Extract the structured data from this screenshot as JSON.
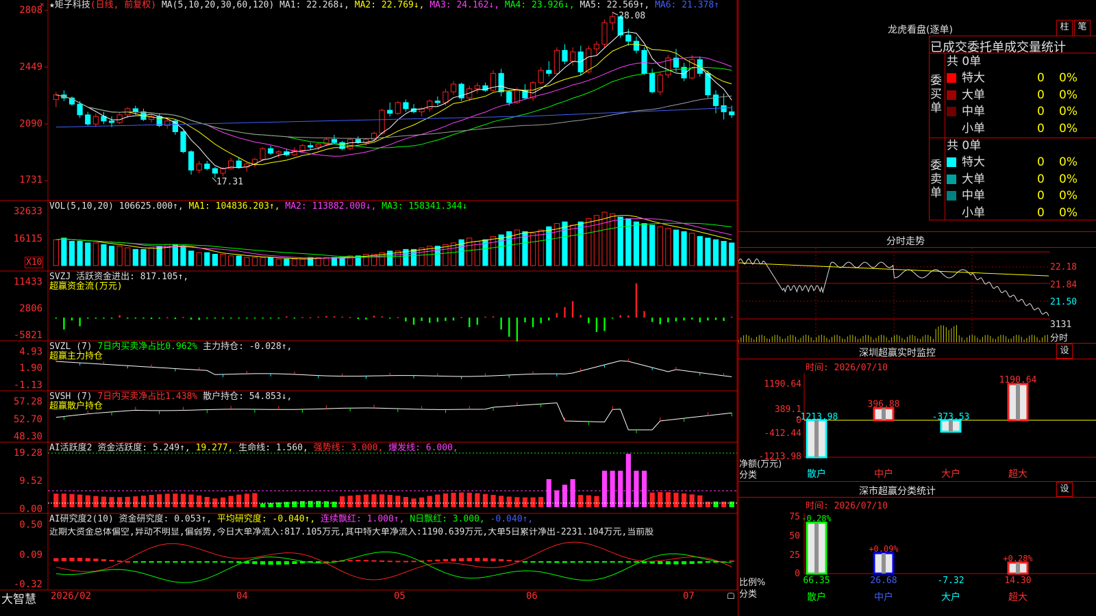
{
  "stock": {
    "name": "★矩子科技",
    "mode": "(日线, 前复权)"
  },
  "colors": {
    "up": "#ff2020",
    "down": "#00ffff",
    "ma1": "#ffffff",
    "ma2": "#ffff00",
    "ma3": "#ff40ff",
    "ma4": "#00ff00",
    "ma5": "#a0a0a0",
    "ma6": "#4060ff"
  },
  "k": {
    "header": {
      "ma": "MA(5,10,20,30,60,120)",
      "ma1": "MA1: 22.268↓,",
      "ma2": "MA2: 22.769↓,",
      "ma3": "MA3: 24.162↓,",
      "ma4": "MA4: 23.926↓,",
      "ma5": "MA5: 22.569↑,",
      "ma6": "MA6: 21.378↑"
    },
    "yticks": [
      "2808",
      "2449",
      "2090",
      "1731"
    ],
    "high_label": "28.08",
    "low_label": "17.31"
  },
  "vol": {
    "header": {
      "name": "VOL(5,10,20)",
      "v": "106625.000↑,",
      "ma1": "MA1: 104836.203↑,",
      "ma2": "MA2: 113882.000↓,",
      "ma3": "MA3: 158341.344↓"
    },
    "yticks": [
      "32633",
      "16115"
    ],
    "unit": "X10"
  },
  "svzj": {
    "header": {
      "name": "SVZJ",
      "t1": "活跃资金进出: 817.105↑,",
      "t2": "超赢资金流(万元)"
    },
    "yticks": [
      "11433",
      "2806",
      "-5821"
    ]
  },
  "svzl": {
    "header": {
      "name": "SVZL (7)",
      "t1": "7日内买卖净占比0.962%",
      "t2": "主力持仓: -0.028↑,",
      "t3": "超赢主力持仓"
    },
    "yticks": [
      "4.93",
      "1.90",
      "-1.13"
    ]
  },
  "svsh": {
    "header": {
      "name": "SVSH (7)",
      "t1": "7日内买卖净占比1.438%",
      "t2": "散户持仓: 54.853↓,",
      "t3": "超赢散户持仓"
    },
    "yticks": [
      "57.28",
      "52.70",
      "48.30"
    ]
  },
  "ai1": {
    "header": {
      "name": "AI活跃度2",
      "t1": "资金活跃度: 5.249↑,",
      "t2": "19.277,",
      "t3": "生命线: 1.560,",
      "t4": "强势线: 3.000,",
      "t5": "爆发线: 6.000,"
    },
    "yticks": [
      "19.28",
      "9.52",
      "0.00"
    ]
  },
  "ai2": {
    "header": {
      "name": "AI研究度2(10)",
      "t1": "资金研究度: 0.053↑,",
      "t2": "平均研究度: -0.040↑,",
      "t3": "连续飘红: 1.000↑,",
      "t4": "N日飘红: 3.000,",
      "t5": "-0.040↑,"
    },
    "desc": "近期大资金总体偏空,异动不明显,偏弱势,今日大单净流入:817.105万元,其中特大单净流入:1190.639万元,大单5日累计净出-2231.104万元,当前股",
    "yticks": [
      "0.50",
      "0.09",
      "-0.32"
    ]
  },
  "xaxis": {
    "labels": [
      "2026/02",
      "04",
      "05",
      "06",
      "07"
    ]
  },
  "footer": {
    "brand": "大智慧"
  },
  "right": {
    "lhb": {
      "title": "龙虎看盘(逐单)",
      "btn1": "柱",
      "btn2": "笔",
      "subtitle": "已成交委托单成交量统计"
    },
    "buy": {
      "side": "委买单",
      "total": "共 0单",
      "rows": [
        {
          "label": "特大",
          "v": "0",
          "p": "0%",
          "color": "#ff0000"
        },
        {
          "label": "大单",
          "v": "0",
          "p": "0%",
          "color": "#a00000"
        },
        {
          "label": "中单",
          "v": "0",
          "p": "0%",
          "color": "#700000"
        },
        {
          "label": "小单",
          "v": "0",
          "p": "0%",
          "color": ""
        }
      ]
    },
    "sell": {
      "side": "委卖单",
      "total": "共 0单",
      "rows": [
        {
          "label": "特大",
          "v": "0",
          "p": "0%",
          "color": "#00ffff"
        },
        {
          "label": "大单",
          "v": "0",
          "p": "0%",
          "color": "#00a0a0"
        },
        {
          "label": "中单",
          "v": "0",
          "p": "0%",
          "color": "#008080"
        },
        {
          "label": "小单",
          "v": "0",
          "p": "0%",
          "color": ""
        }
      ]
    },
    "intraday": {
      "title": "分时走势",
      "yticks": [
        "22.18",
        "21.84",
        "21.50"
      ],
      "vol": "3131",
      "vol_unit": "分时"
    },
    "monitor": {
      "title": "深圳超赢实时监控",
      "btn": "设",
      "date": "时间: 2026/07/10",
      "yticks": [
        "1190.64",
        "389.1",
        "0",
        "-412.44",
        "-1213.98"
      ],
      "ylabel1": "净额(万元)",
      "ylabel2": "分类",
      "bars": [
        {
          "cat": "散户",
          "value": -1213.98,
          "label": "-1213.98"
        },
        {
          "cat": "中户",
          "value": 396.88,
          "label": "396.88"
        },
        {
          "cat": "大户",
          "value": -373.53,
          "label": "-373.53"
        },
        {
          "cat": "超大",
          "value": 1190.64,
          "label": "1190.64"
        }
      ]
    },
    "classify": {
      "title": "深市超赢分类统计",
      "btn": "设",
      "date": "时间: 2026/07/10",
      "yticks": [
        "75",
        "50",
        "25",
        "0"
      ],
      "ylabel1": "比例%",
      "ylabel2": "分类",
      "bars": [
        {
          "cat": "散户",
          "value": 66.35,
          "label": "66.35",
          "chg": "-0.28%"
        },
        {
          "cat": "中户",
          "value": 26.68,
          "label": "26.68",
          "chg": "+0.09%"
        },
        {
          "cat": "大户",
          "value": -7.32,
          "label": "-7.32",
          "chg": ""
        },
        {
          "cat": "超大",
          "value": 14.3,
          "label": "14.30",
          "chg": "+0.28%"
        }
      ]
    }
  },
  "chart_data": [
    {
      "type": "candlestick",
      "title": "矩子科技 日线",
      "ylim": [
        16.5,
        28.5
      ],
      "candles": [
        [
          22.4,
          22.9,
          21.9,
          22.7
        ],
        [
          22.7,
          23.0,
          22.3,
          22.5
        ],
        [
          22.5,
          22.6,
          22.0,
          22.1
        ],
        [
          22.1,
          22.3,
          21.2,
          21.4
        ],
        [
          21.4,
          21.6,
          20.7,
          20.8
        ],
        [
          20.8,
          21.5,
          20.6,
          21.3
        ],
        [
          21.3,
          21.6,
          20.8,
          21.0
        ],
        [
          21.0,
          21.3,
          20.6,
          20.9
        ],
        [
          20.9,
          21.5,
          20.8,
          21.4
        ],
        [
          21.4,
          21.9,
          21.2,
          21.8
        ],
        [
          21.8,
          22.0,
          21.4,
          21.6
        ],
        [
          21.6,
          21.8,
          21.0,
          21.1
        ],
        [
          21.1,
          21.4,
          20.9,
          21.3
        ],
        [
          21.3,
          21.5,
          20.6,
          20.7
        ],
        [
          20.7,
          21.2,
          20.5,
          21.0
        ],
        [
          21.0,
          21.1,
          20.1,
          20.3
        ],
        [
          20.3,
          20.4,
          18.9,
          19.0
        ],
        [
          19.0,
          19.1,
          17.5,
          17.8
        ],
        [
          17.8,
          18.4,
          17.6,
          18.2
        ],
        [
          18.2,
          18.4,
          17.8,
          17.9
        ],
        [
          17.9,
          18.0,
          17.3,
          17.6
        ],
        [
          17.6,
          18.0,
          17.4,
          17.9
        ],
        [
          17.9,
          18.6,
          17.8,
          18.4
        ],
        [
          18.4,
          18.6,
          17.9,
          18.0
        ],
        [
          18.0,
          18.3,
          17.7,
          18.2
        ],
        [
          18.2,
          18.6,
          18.0,
          18.5
        ],
        [
          18.5,
          19.3,
          18.4,
          19.2
        ],
        [
          19.2,
          19.4,
          18.8,
          18.9
        ],
        [
          18.9,
          19.1,
          18.6,
          19.0
        ],
        [
          19.0,
          19.2,
          18.7,
          18.8
        ],
        [
          18.8,
          19.3,
          18.7,
          19.1
        ],
        [
          19.1,
          19.5,
          19.0,
          19.4
        ],
        [
          19.4,
          19.6,
          19.1,
          19.3
        ],
        [
          19.3,
          19.6,
          19.1,
          19.5
        ],
        [
          19.5,
          19.9,
          19.4,
          19.8
        ],
        [
          19.8,
          20.1,
          19.5,
          19.6
        ],
        [
          19.6,
          19.7,
          19.1,
          19.2
        ],
        [
          19.2,
          19.9,
          19.1,
          19.8
        ],
        [
          19.8,
          20.0,
          19.5,
          19.6
        ],
        [
          19.6,
          19.9,
          19.4,
          19.8
        ],
        [
          19.8,
          20.3,
          19.7,
          20.2
        ],
        [
          20.2,
          21.8,
          20.1,
          21.7
        ],
        [
          21.7,
          22.2,
          21.3,
          21.5
        ],
        [
          21.5,
          22.3,
          21.4,
          22.2
        ],
        [
          22.2,
          22.4,
          21.6,
          21.8
        ],
        [
          21.8,
          22.1,
          21.5,
          21.6
        ],
        [
          21.6,
          21.9,
          21.3,
          21.8
        ],
        [
          21.8,
          22.4,
          21.6,
          22.3
        ],
        [
          22.3,
          22.6,
          22.0,
          22.2
        ],
        [
          22.2,
          23.1,
          22.0,
          22.9
        ],
        [
          22.9,
          23.6,
          22.7,
          23.4
        ],
        [
          23.4,
          23.5,
          22.3,
          22.5
        ],
        [
          22.5,
          23.3,
          22.3,
          23.1
        ],
        [
          23.1,
          23.5,
          22.8,
          23.3
        ],
        [
          23.3,
          23.5,
          22.9,
          23.0
        ],
        [
          23.0,
          24.3,
          22.9,
          24.1
        ],
        [
          24.1,
          24.4,
          22.6,
          22.9
        ],
        [
          22.9,
          23.0,
          22.0,
          22.2
        ],
        [
          22.2,
          23.2,
          22.1,
          23.0
        ],
        [
          23.0,
          23.4,
          22.4,
          22.5
        ],
        [
          22.5,
          23.6,
          22.3,
          23.5
        ],
        [
          23.5,
          24.5,
          23.4,
          24.3
        ],
        [
          24.3,
          24.9,
          23.9,
          24.1
        ],
        [
          24.1,
          25.8,
          24.0,
          25.6
        ],
        [
          25.6,
          26.0,
          24.7,
          24.9
        ],
        [
          24.9,
          25.8,
          24.6,
          25.5
        ],
        [
          25.5,
          25.9,
          24.0,
          24.2
        ],
        [
          24.2,
          25.9,
          24.1,
          25.7
        ],
        [
          25.7,
          26.2,
          25.3,
          26.0
        ],
        [
          26.0,
          27.6,
          25.8,
          27.4
        ],
        [
          27.4,
          28.1,
          26.9,
          27.8
        ],
        [
          27.8,
          27.9,
          26.4,
          26.6
        ],
        [
          26.6,
          27.0,
          25.9,
          26.2
        ],
        [
          26.2,
          26.5,
          25.4,
          25.6
        ],
        [
          25.6,
          25.8,
          24.0,
          24.1
        ],
        [
          24.1,
          24.4,
          22.8,
          22.9
        ],
        [
          22.9,
          24.2,
          22.7,
          24.0
        ],
        [
          24.0,
          25.3,
          23.8,
          25.1
        ],
        [
          25.1,
          25.7,
          24.2,
          24.5
        ],
        [
          24.5,
          24.8,
          23.6,
          23.8
        ],
        [
          23.8,
          25.3,
          23.7,
          25.0
        ],
        [
          25.0,
          25.2,
          23.9,
          24.1
        ],
        [
          24.1,
          24.3,
          22.5,
          22.7
        ],
        [
          22.7,
          23.0,
          21.5,
          22.0
        ],
        [
          22.0,
          22.8,
          21.1,
          21.6
        ],
        [
          21.6,
          22.0,
          21.2,
          21.4
        ]
      ]
    },
    {
      "type": "bar",
      "title": "VOL(5,10,20)",
      "values": [
        16,
        17,
        15,
        15,
        14,
        14,
        13,
        12,
        12,
        11,
        10,
        10,
        11,
        12,
        13,
        13,
        12,
        9,
        8,
        8,
        7,
        7,
        6,
        6,
        5,
        5,
        5,
        5,
        4,
        4,
        4,
        4,
        5,
        5,
        5,
        5,
        5,
        6,
        6,
        7,
        7,
        8,
        9,
        9,
        10,
        10,
        11,
        12,
        12,
        13,
        14,
        16,
        17,
        15,
        16,
        18,
        19,
        21,
        22,
        21,
        20,
        22,
        24,
        26,
        27,
        25,
        27,
        29,
        31,
        33,
        32,
        30,
        29,
        27,
        26,
        25,
        24,
        23,
        22,
        21,
        20,
        18,
        17,
        16,
        15,
        14
      ]
    },
    {
      "type": "bar",
      "title": "超赢资金流(万元)",
      "values": [
        -200,
        -2500,
        -600,
        -1800,
        -100,
        -200,
        -100,
        -150,
        800,
        -100,
        -200,
        -100,
        -300,
        -100,
        100,
        -300,
        200,
        -400,
        -500,
        -200,
        -100,
        -100,
        -200,
        -150,
        -200,
        -100,
        -100,
        -200,
        -100,
        400,
        -100,
        200,
        100,
        300,
        500,
        400,
        300,
        200,
        -300,
        -400,
        600,
        400,
        -100,
        200,
        -800,
        -1500,
        -700,
        -1100,
        -900,
        -700,
        -600,
        200,
        -2000,
        -1500,
        300,
        400,
        -2500,
        -4000,
        -5000,
        -1000,
        -2000,
        -1200,
        -600,
        1500,
        3500,
        5500,
        900,
        -1200,
        -3000,
        -2800,
        -200,
        800,
        700,
        11433,
        2200,
        -900,
        -1400,
        -1000,
        -800,
        -600,
        -400,
        -1000,
        -600,
        -500,
        -700,
        300
      ]
    },
    {
      "type": "line",
      "title": "超赢主力持仓",
      "ylim": [
        -1.13,
        4.93
      ]
    },
    {
      "type": "line",
      "title": "超赢散户持仓",
      "ylim": [
        48.3,
        57.28
      ]
    },
    {
      "type": "bar",
      "title": "AI活跃度2",
      "ylim": [
        0,
        19.28
      ]
    },
    {
      "type": "bar",
      "title": "AI研究度2(10)",
      "ylim": [
        -0.32,
        0.5
      ]
    }
  ]
}
